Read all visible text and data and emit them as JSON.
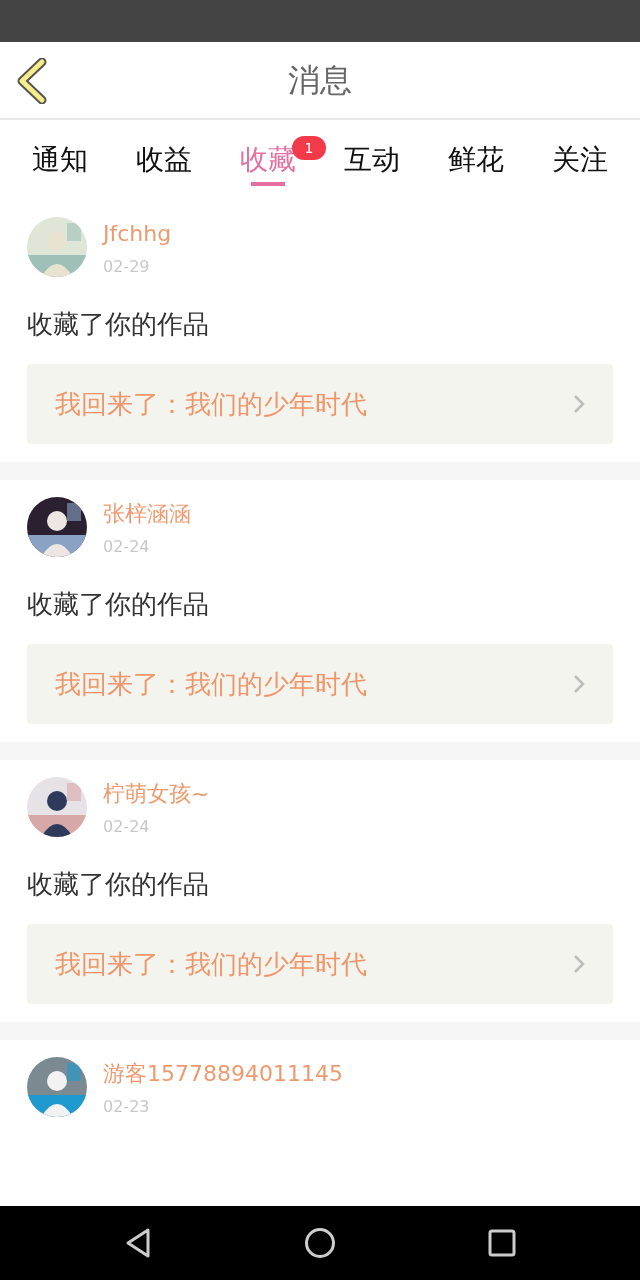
{
  "header": {
    "title": "消息"
  },
  "tabs": [
    {
      "label": "通知",
      "selected": false
    },
    {
      "label": "收益",
      "selected": false
    },
    {
      "label": "收藏",
      "selected": true,
      "badge": "1"
    },
    {
      "label": "互动",
      "selected": false
    },
    {
      "label": "鲜花",
      "selected": false
    },
    {
      "label": "关注",
      "selected": false
    }
  ],
  "messages": [
    {
      "user": "Jfchhg",
      "date": "02-29",
      "action": "收藏了你的作品",
      "work": "我回来了：我们的少年时代"
    },
    {
      "user": "张梓涵涵",
      "date": "02-24",
      "action": "收藏了你的作品",
      "work": "我回来了：我们的少年时代"
    },
    {
      "user": "柠萌女孩~",
      "date": "02-24",
      "action": "收藏了你的作品",
      "work": "我回来了：我们的少年时代"
    },
    {
      "user": "游客15778894011145",
      "date": "02-23"
    }
  ]
}
